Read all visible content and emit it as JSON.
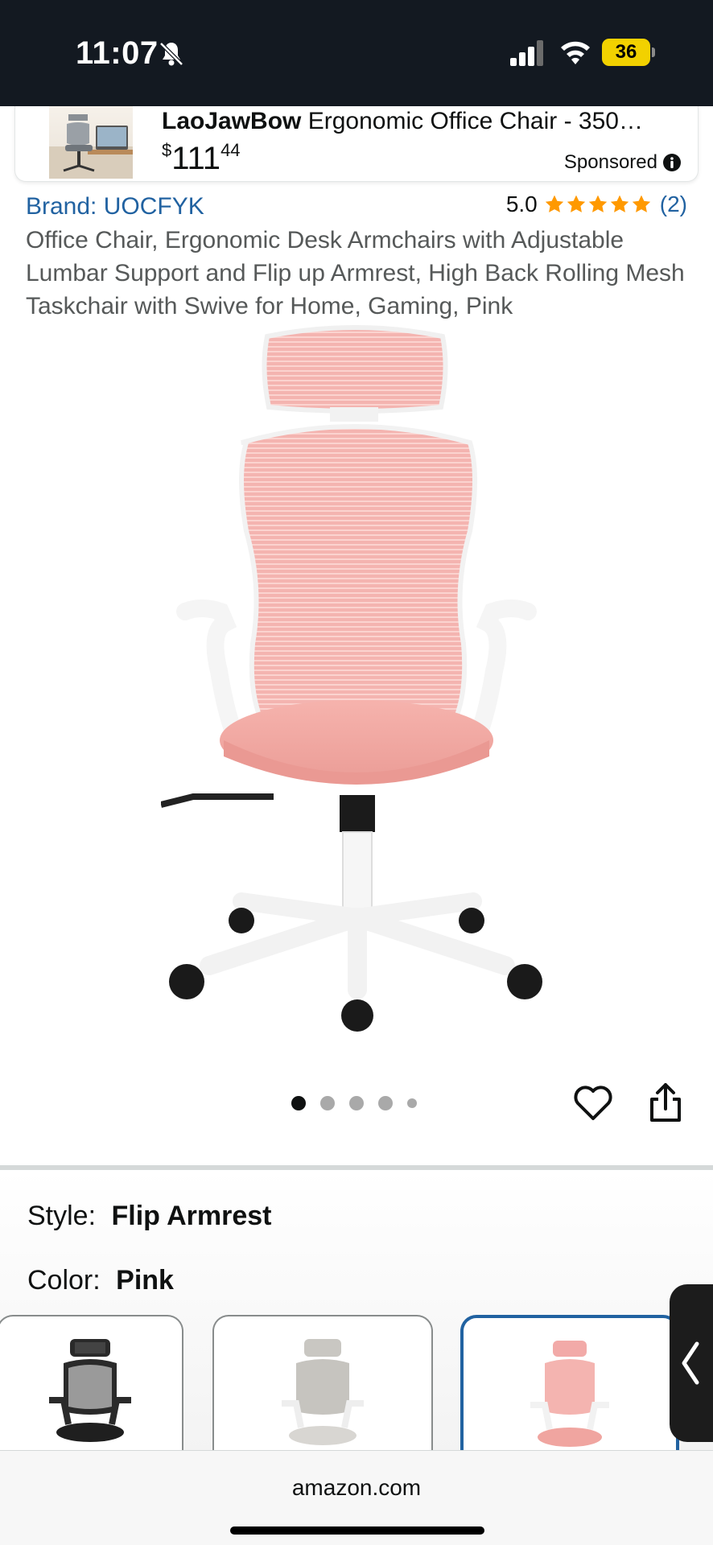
{
  "status_bar": {
    "time": "11:07",
    "battery_level": "36",
    "icons": [
      "bell-slash-icon",
      "signal-icon",
      "wifi-icon",
      "battery-icon"
    ]
  },
  "sponsored": {
    "brand": "LaoJawBow",
    "title_rest": " Ergonomic Office Chair - 350…",
    "price_currency": "$",
    "price_whole": "111",
    "price_cents": "44",
    "label": "Sponsored",
    "info_icon": "info-icon"
  },
  "product": {
    "brand_link": "Brand: UOCFYK",
    "rating_value": "5.0",
    "rating_stars": 5,
    "rating_count": "(2)",
    "title": "Office Chair, Ergonomic Desk Armchairs with Adjustable Lumbar Support and Flip up Armrest, High Back Rolling Mesh Taskchair with Swive for Home, Gaming, Pink"
  },
  "carousel": {
    "total_images": 5,
    "active_index": 0,
    "actions": [
      "heart-icon",
      "share-icon"
    ]
  },
  "options": {
    "style_label": "Style:",
    "style_value": "Flip Armrest",
    "color_label": "Color:",
    "color_value": "Pink",
    "swatches": [
      {
        "name": "black",
        "selected": false
      },
      {
        "name": "gray",
        "selected": false
      },
      {
        "name": "pink",
        "selected": true
      }
    ]
  },
  "colors": {
    "header_bg": "#131921",
    "link": "#2162a1",
    "star": "#ff9900",
    "battery": "#f2d100",
    "chair_pink": "#f2aaa8"
  },
  "browser": {
    "url": "amazon.com"
  }
}
